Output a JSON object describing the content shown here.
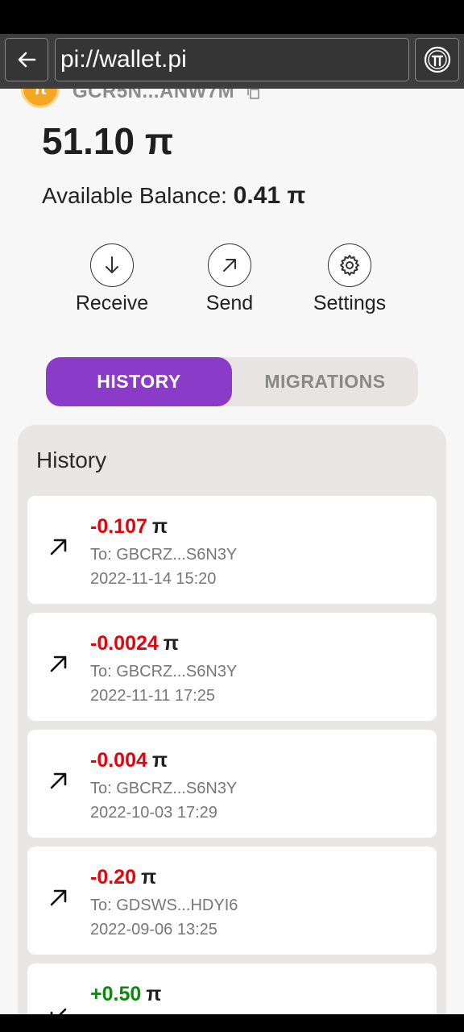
{
  "browser": {
    "url": "pi://wallet.pi",
    "back_icon": "arrow-left-icon",
    "pi_icon": "pi-logo-icon"
  },
  "wallet": {
    "address": "GCR5N...ANW7M",
    "balance": "51.10 π",
    "available_label": "Available Balance:",
    "available_value": "0.41 π"
  },
  "actions": [
    {
      "label": "Receive",
      "icon": "arrow-down-icon"
    },
    {
      "label": "Send",
      "icon": "arrow-up-right-icon"
    },
    {
      "label": "Settings",
      "icon": "gear-icon"
    }
  ],
  "tabs": {
    "history": "HISTORY",
    "migrations": "MIGRATIONS",
    "active": "HISTORY",
    "accent": "#8a3bc8"
  },
  "history": {
    "title": "History",
    "items": [
      {
        "amount": "-0.107",
        "unit": "π",
        "to": "To: GBCRZ...S6N3Y",
        "date": "2022-11-14 15:20",
        "direction": "out"
      },
      {
        "amount": "-0.0024",
        "unit": "π",
        "to": "To: GBCRZ...S6N3Y",
        "date": "2022-11-11 17:25",
        "direction": "out"
      },
      {
        "amount": "-0.004",
        "unit": "π",
        "to": "To: GBCRZ...S6N3Y",
        "date": "2022-10-03 17:29",
        "direction": "out"
      },
      {
        "amount": "-0.20",
        "unit": "π",
        "to": "To: GDSWS...HDYI6",
        "date": "2022-09-06 13:25",
        "direction": "out"
      },
      {
        "amount": "+0.50",
        "unit": "π",
        "to": "",
        "date": "",
        "direction": "in"
      }
    ]
  },
  "colors": {
    "negative": "#e8000b",
    "positive": "#0a8a0a"
  }
}
